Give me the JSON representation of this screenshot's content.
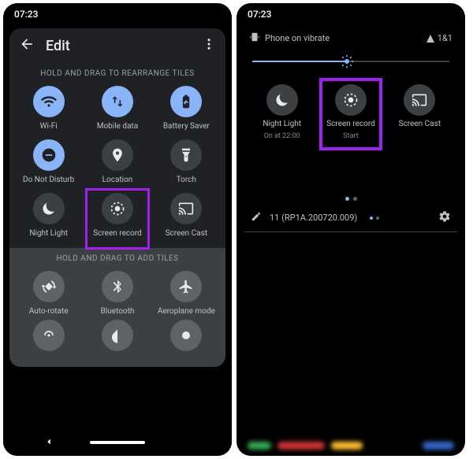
{
  "left": {
    "clock": "07:23",
    "title": "Edit",
    "hint_rearrange": "HOLD AND DRAG TO REARRANGE TILES",
    "hint_add": "HOLD AND DRAG TO ADD TILES",
    "tiles": [
      {
        "label": "Wi-Fi"
      },
      {
        "label": "Mobile data"
      },
      {
        "label": "Battery Saver"
      },
      {
        "label": "Do Not Disturb"
      },
      {
        "label": "Location"
      },
      {
        "label": "Torch"
      },
      {
        "label": "Night Light"
      },
      {
        "label": "Screen record"
      },
      {
        "label": "Screen Cast"
      }
    ],
    "add_tiles": [
      {
        "label": "Auto-rotate"
      },
      {
        "label": "Bluetooth"
      },
      {
        "label": "Aeroplane mode"
      }
    ]
  },
  "right": {
    "clock": "07:23",
    "vibrate_text": "Phone on vibrate",
    "signal_label": "1&1",
    "tiles": [
      {
        "label": "Night Light",
        "sub": "On at 22:00"
      },
      {
        "label": "Screen record",
        "sub": "Start"
      },
      {
        "label": "Screen Cast",
        "sub": ""
      }
    ],
    "build": "11 (RP1A.200720.009)"
  },
  "colors": {
    "accent": "#8ab4f8",
    "highlight": "#a020f0"
  }
}
